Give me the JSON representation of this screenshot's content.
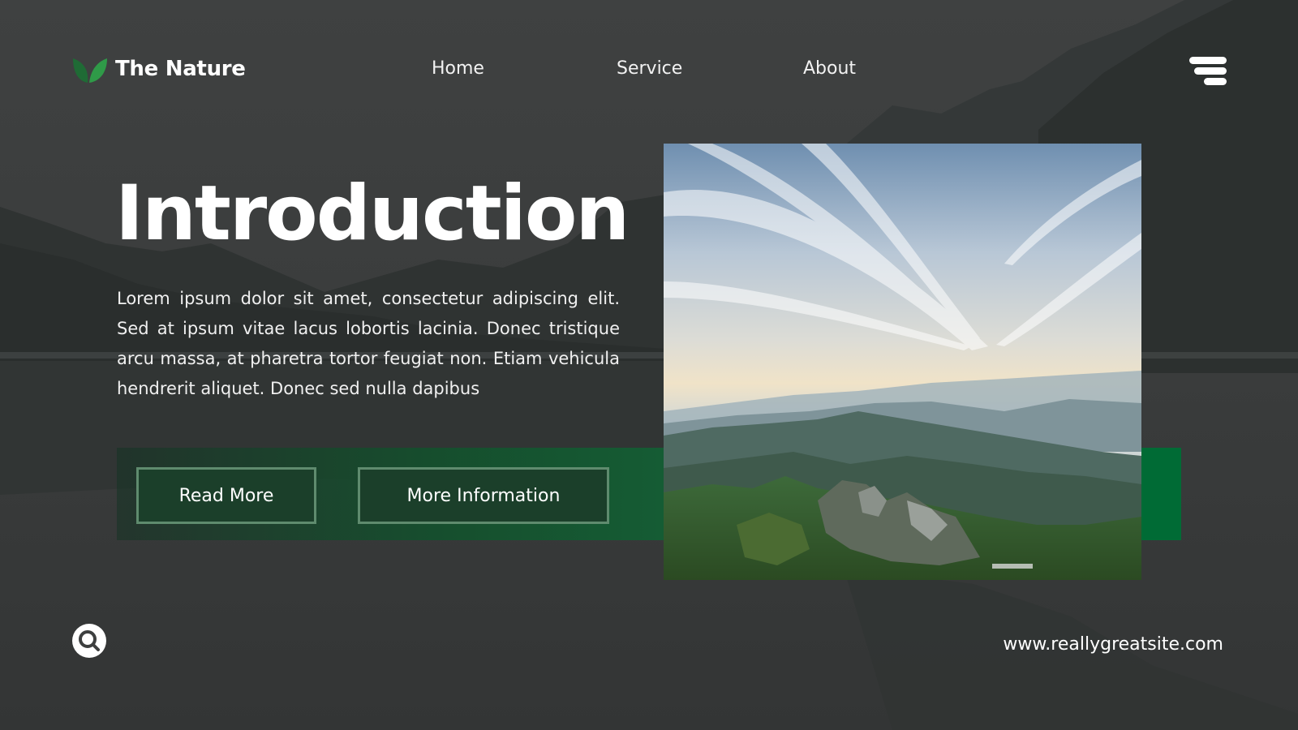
{
  "brand": {
    "name": "The Nature",
    "logo_icon": "leaf-icon",
    "accent_color": "#1f8f3e"
  },
  "nav": {
    "items": [
      {
        "label": "Home"
      },
      {
        "label": "Service"
      },
      {
        "label": "About"
      }
    ],
    "menu_icon": "hamburger-menu-icon"
  },
  "hero": {
    "title": "Introduction",
    "body": "Lorem ipsum dolor sit amet, consectetur adipiscing elit. Sed at ipsum vitae lacus lobortis lacinia. Donec tristique arcu massa, at pharetra tortor feugiat non. Etiam vehicula hendrerit aliquet. Donec sed nulla dapibus",
    "buttons": {
      "read_more": "Read More",
      "more_info": "More Information"
    }
  },
  "footer": {
    "search_icon": "search-icon",
    "url": "www.reallygreatsite.com"
  },
  "colors": {
    "background": "#3d3f3f",
    "band_green": "#155c34",
    "accent_green": "#006b35",
    "button_border": "#5f8b6e"
  }
}
